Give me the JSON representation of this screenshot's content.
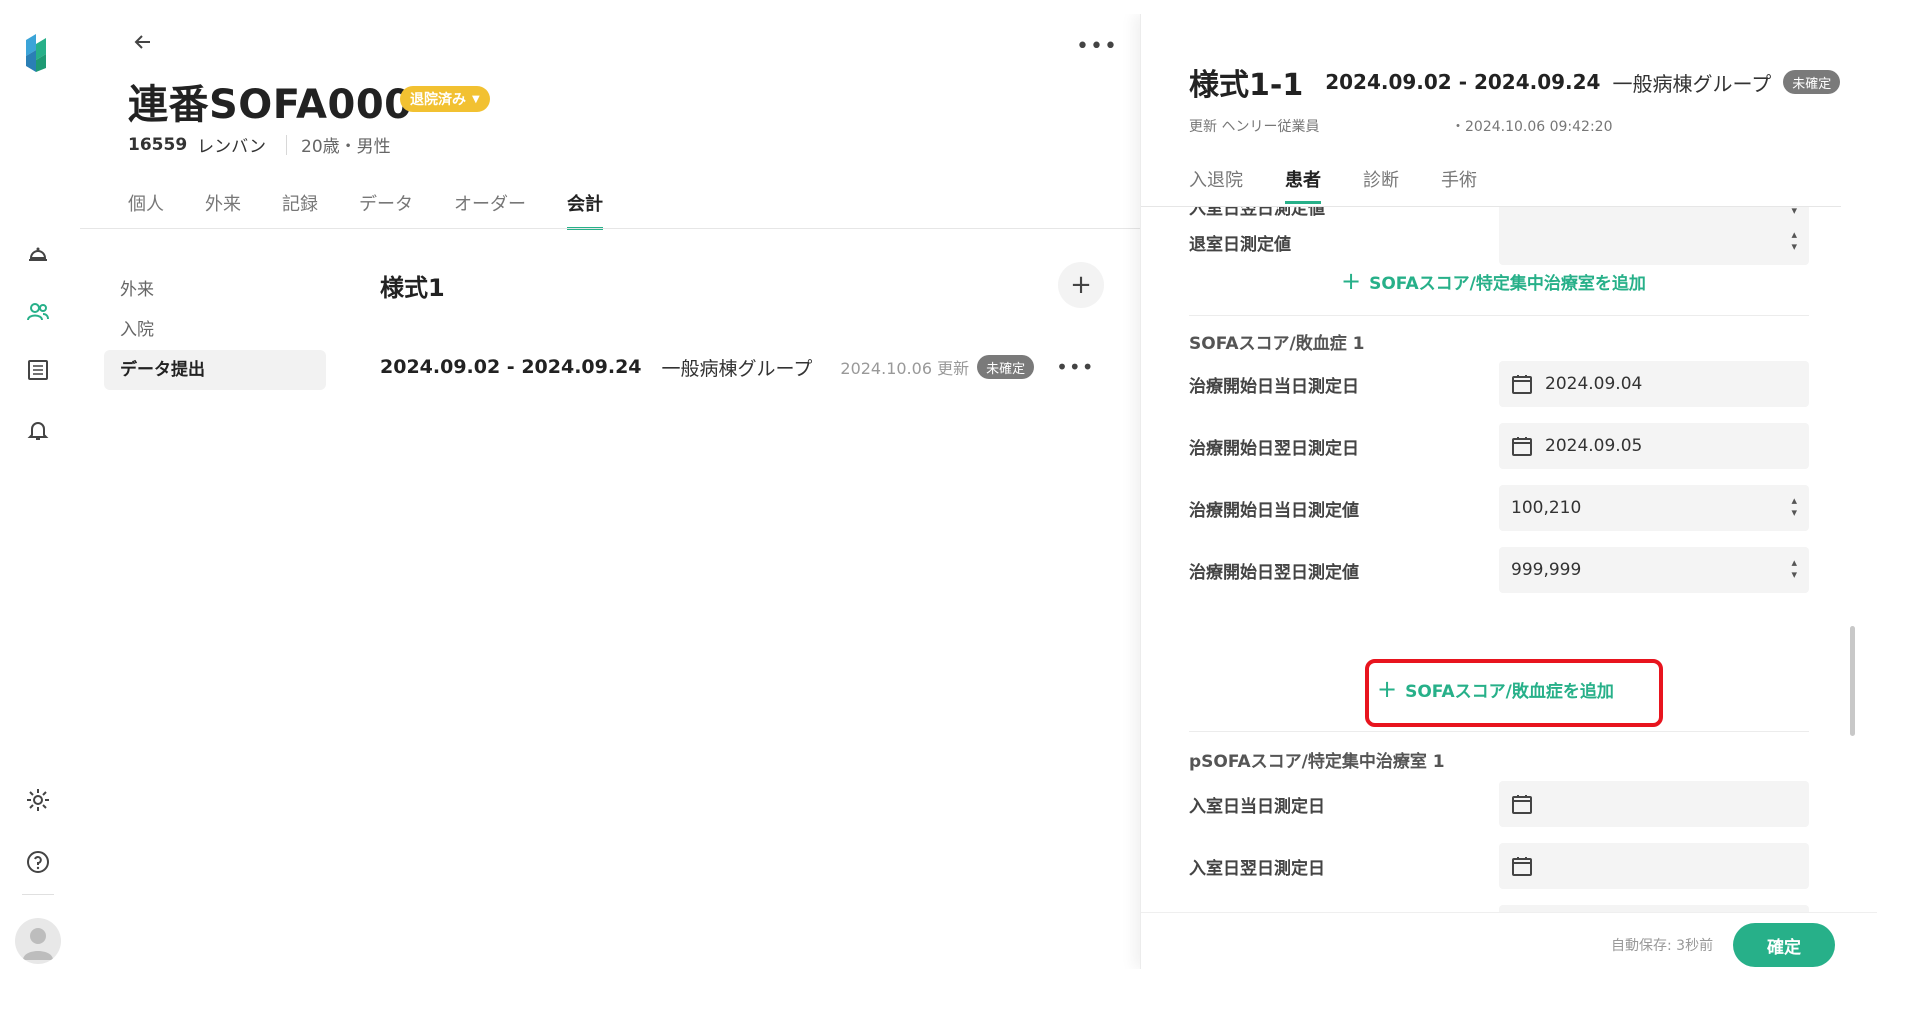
{
  "header": {
    "title": "連番SOFA000",
    "status_badge": "退院済み",
    "patient_id": "16559",
    "patient_name": "レンバン",
    "patient_info": "20歳・男性"
  },
  "main_tabs": [
    {
      "label": "個人"
    },
    {
      "label": "外来"
    },
    {
      "label": "記録"
    },
    {
      "label": "データ"
    },
    {
      "label": "オーダー"
    },
    {
      "label": "会計"
    }
  ],
  "subnav": [
    {
      "label": "外来"
    },
    {
      "label": "入院"
    },
    {
      "label": "データ提出"
    }
  ],
  "content": {
    "section_title": "様式1",
    "entry": {
      "period": "2024.09.02 - 2024.09.24",
      "group": "一般病棟グループ",
      "updated": "2024.10.06 更新",
      "status": "未確定"
    }
  },
  "panel": {
    "form": "様式1-1",
    "period": "2024.09.02 - 2024.09.24",
    "group": "一般病棟グループ",
    "status": "未確定",
    "updated_by": "更新 ヘンリー従業員",
    "updated_at": "・2024.10.06 09:42:20",
    "tabs": [
      {
        "label": "入退院"
      },
      {
        "label": "患者"
      },
      {
        "label": "診断"
      },
      {
        "label": "手術"
      }
    ],
    "partial_row_label": "入室日翌日測定値",
    "exit_row": {
      "label": "退室日測定値",
      "value": ""
    },
    "add_sofa_icu": "SOFAスコア/特定集中治療室を追加",
    "sofa_group_title": "SOFAスコア/敗血症 1",
    "sofa_rows": [
      {
        "label": "治療開始日当日測定日",
        "value": "2024.09.04"
      },
      {
        "label": "治療開始日翌日測定日",
        "value": "2024.09.05"
      },
      {
        "label": "治療開始日当日測定値",
        "value": "100,210"
      },
      {
        "label": "治療開始日翌日測定値",
        "value": "999,999"
      }
    ],
    "add_sofa_sepsis": "SOFAスコア/敗血症を追加",
    "psofa_group_title": "pSOFAスコア/特定集中治療室 1",
    "psofa_rows": [
      {
        "label": "入室日当日測定日",
        "value": ""
      },
      {
        "label": "入室日翌日測定日",
        "value": ""
      }
    ],
    "autosave": "自動保存: 3秒前",
    "confirm": "確定"
  },
  "colors": {
    "accent": "#27b089",
    "badge_yellow": "#f2c131",
    "badge_gray": "#7a7a7a",
    "highlight": "#e8141e"
  }
}
